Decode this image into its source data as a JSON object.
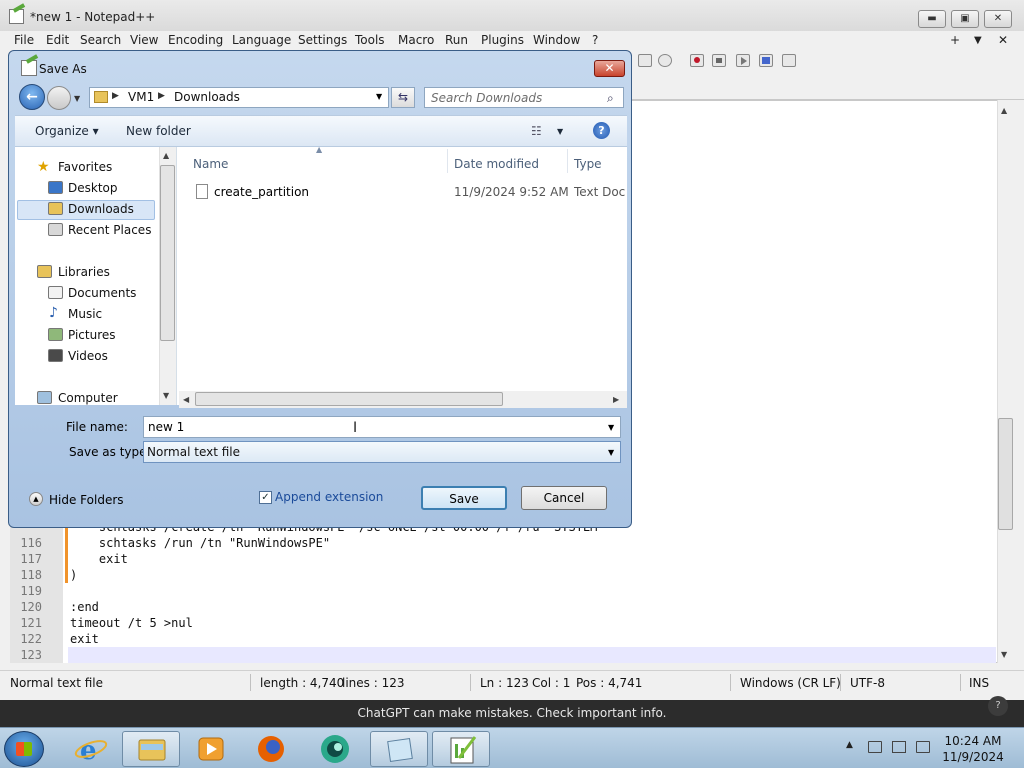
{
  "app": {
    "title": "*new 1 - Notepad++",
    "window_buttons": [
      "▬",
      "▣",
      "✕"
    ],
    "menu": [
      "File",
      "Edit",
      "Search",
      "View",
      "Encoding",
      "Language",
      "Settings",
      "Tools",
      "Macro",
      "Run",
      "Plugins",
      "Window",
      "?"
    ],
    "menu_right": [
      "+",
      "▼",
      "✕"
    ]
  },
  "editor": {
    "lines": [
      {
        "num": "",
        "text": "    schtasks /create /tn \"RunWindowsPE\" /sc ONCE /st 00:00 /f /ru \"SYSTEM\""
      },
      {
        "num": "116",
        "text": "    schtasks /run /tn \"RunWindowsPE\""
      },
      {
        "num": "117",
        "text": "    exit"
      },
      {
        "num": "118",
        "text": ")"
      },
      {
        "num": "119",
        "text": ""
      },
      {
        "num": "120",
        "text": ":end"
      },
      {
        "num": "121",
        "text": "timeout /t 5 >nul"
      },
      {
        "num": "122",
        "text": "exit"
      },
      {
        "num": "123",
        "text": ""
      }
    ]
  },
  "status": {
    "filetype": "Normal text file",
    "length": "length : 4,740",
    "lines": "lines : 123",
    "ln": "Ln : 123",
    "col": "Col : 1",
    "pos": "Pos : 4,741",
    "eol": "Windows (CR LF)",
    "encoding": "UTF-8",
    "mode": "INS"
  },
  "banner": {
    "text": "ChatGPT can make mistakes. Check important info.",
    "help": "?"
  },
  "dialog": {
    "title": "Save As",
    "close": "✕",
    "breadcrumb": [
      "VM1",
      "Downloads"
    ],
    "search_placeholder": "Search Downloads",
    "organize": "Organize ▾",
    "new_folder": "New folder",
    "help": "?",
    "nav": {
      "favorites": "Favorites",
      "desktop": "Desktop",
      "downloads": "Downloads",
      "recent": "Recent Places",
      "libraries": "Libraries",
      "documents": "Documents",
      "music": "Music",
      "pictures": "Pictures",
      "videos": "Videos",
      "computer": "Computer"
    },
    "columns": [
      "Name",
      "Date modified",
      "Type"
    ],
    "files": [
      {
        "name": "create_partition",
        "date": "11/9/2024 9:52 AM",
        "type": "Text Docu"
      }
    ],
    "file_name_label": "File name:",
    "file_name_value": "new 1",
    "save_type_label": "Save as type:",
    "save_type_value": "Normal text file",
    "hide_folders": "Hide Folders",
    "append_extension": "Append extension",
    "append_checked": true,
    "save": "Save",
    "cancel": "Cancel"
  },
  "taskbar": {
    "time": "10:24 AM",
    "date": "11/9/2024",
    "apps": [
      "internet-explorer",
      "file-explorer",
      "media-player",
      "firefox",
      "app-5",
      "app-6",
      "notepad-plus-plus"
    ]
  },
  "colors": {
    "accent": "#3c7fb1",
    "banner": "#2c2c2c",
    "fold": "#f0932b"
  }
}
